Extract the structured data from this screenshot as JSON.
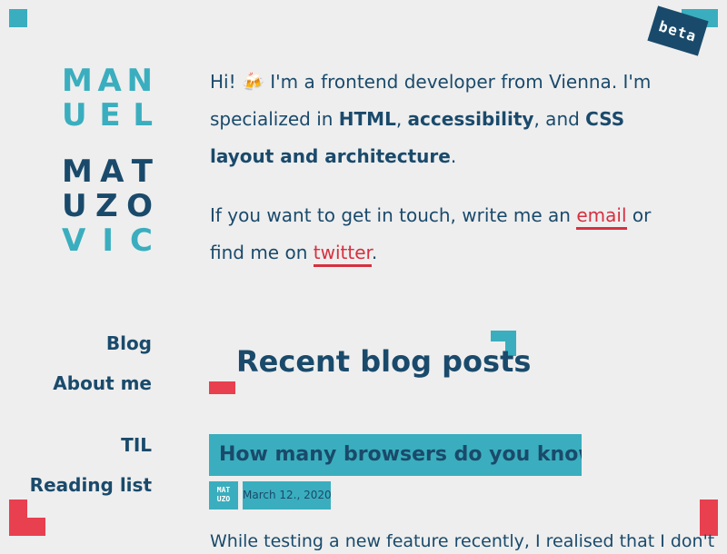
{
  "badge": "beta",
  "logo": {
    "row1": [
      "M",
      "A",
      "N"
    ],
    "row2": [
      "U",
      "E",
      "L"
    ],
    "row3": [
      "M",
      "A",
      "T"
    ],
    "row4": [
      "U",
      "Z",
      "O"
    ],
    "row5": [
      "V",
      "I",
      "C"
    ]
  },
  "nav": {
    "blog": "Blog",
    "about": "About me",
    "til": "TIL",
    "reading": "Reading list"
  },
  "intro": {
    "t1": "Hi! 🍻 I'm a frontend developer from Vienna. I'm specialized in ",
    "html": "HTML",
    "t2": ", ",
    "a11y": "accessibility",
    "t3": ", and ",
    "css": "CSS layout and architecture",
    "t4": "."
  },
  "contact": {
    "t1": "If you want to get in touch, write me an ",
    "email": "email",
    "t2": " or find me on ",
    "twitter": "twitter",
    "t3": "."
  },
  "section_title": "Recent blog posts",
  "post": {
    "title": "How many browsers do you know?",
    "logo_line1": "MAT",
    "logo_line2": "UZO",
    "date": "March 12., 2020",
    "excerpt": "While testing a new feature recently, I realised that I don't"
  },
  "colors": {
    "background": "#eeeeee",
    "navy": "#1a4a6b",
    "teal": "#3aaebe",
    "red": "#e8404f"
  }
}
